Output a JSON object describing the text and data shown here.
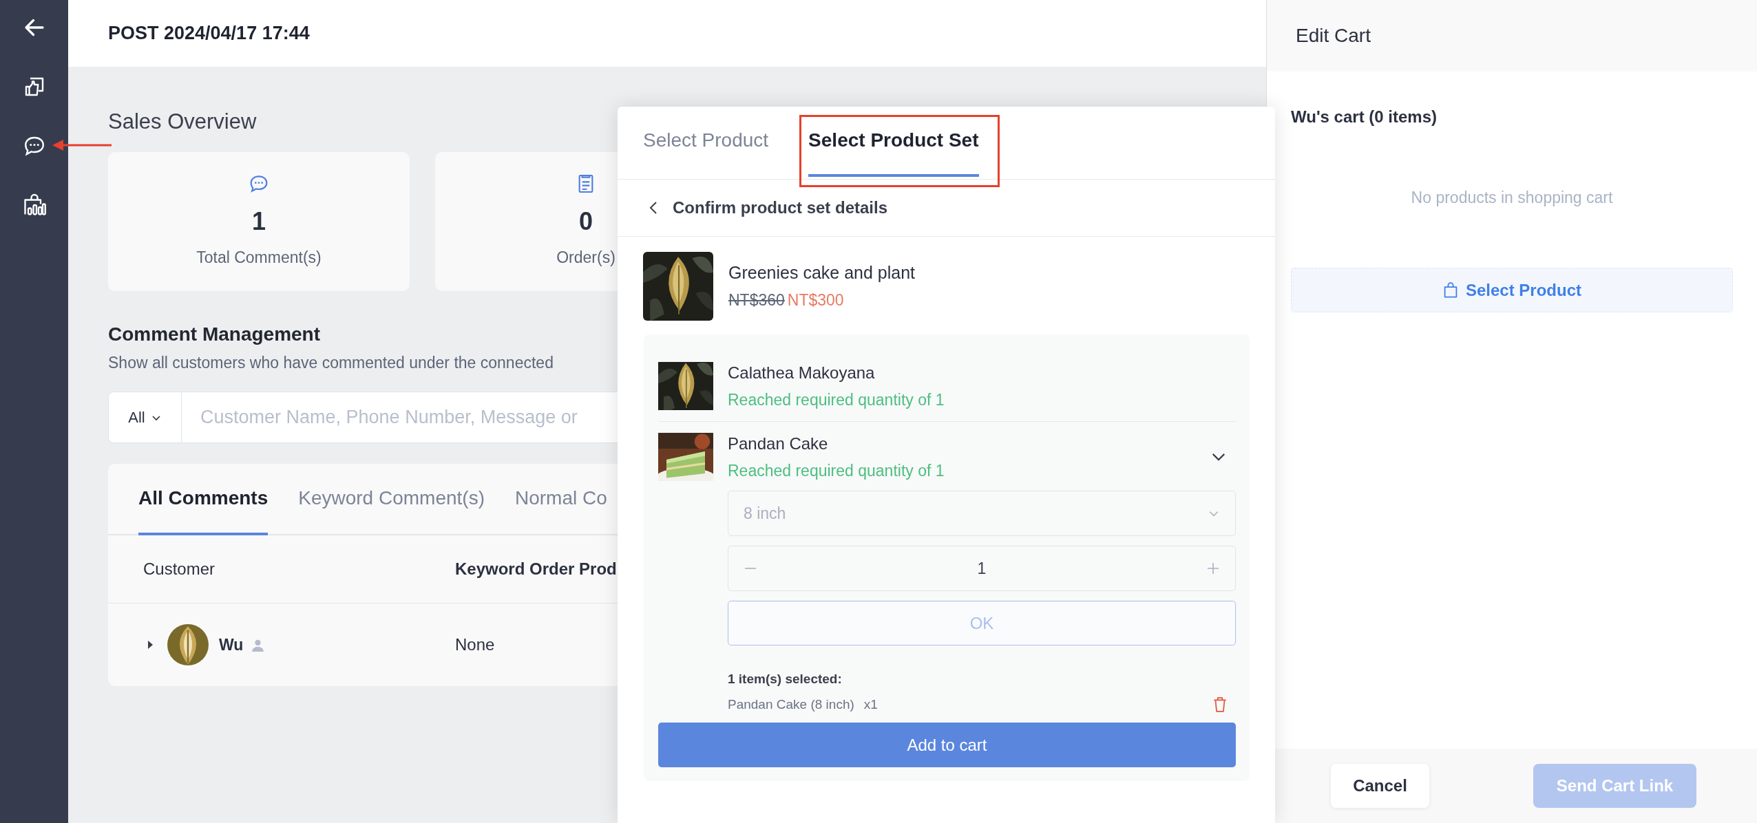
{
  "header": {
    "title": "POST 2024/04/17 17:44"
  },
  "sales_overview": {
    "title": "Sales Overview",
    "cards": [
      {
        "kind": "comments",
        "value": "1",
        "label": "Total Comment(s)"
      },
      {
        "kind": "orders",
        "value": "0",
        "label": "Order(s)"
      }
    ]
  },
  "comment_management": {
    "title": "Comment Management",
    "description": "Show all customers who have commented under the connected",
    "filter": {
      "value": "All"
    },
    "search": {
      "placeholder": "Customer Name, Phone Number, Message or"
    },
    "tabs": [
      {
        "label": "All Comments",
        "selected": true
      },
      {
        "label": "Keyword Comment(s)",
        "selected": false
      },
      {
        "label": "Normal Co",
        "selected": false
      }
    ],
    "columns": [
      "Customer",
      "Keyword Order Prod"
    ],
    "rows": [
      {
        "customer": "Wu",
        "expanded": false,
        "column_2": "None"
      }
    ]
  },
  "product_picker": {
    "tabs": [
      {
        "label": "Select Product",
        "selected": false
      },
      {
        "label": "Select Product Set",
        "selected": true
      }
    ],
    "back_title": "Confirm product set details",
    "product": {
      "name": "Greenies cake and plant",
      "original_price": "NT$360",
      "price": "NT$300"
    },
    "items": [
      {
        "name": "Calathea Makoyana",
        "status": "Reached required quantity of 1",
        "expanded": false
      },
      {
        "name": "Pandan Cake",
        "status": "Reached required quantity of 1",
        "expanded": true,
        "option": {
          "value": "8 inch"
        },
        "quantity": "1",
        "confirm_button": {
          "label": "OK",
          "disabled": true
        }
      }
    ],
    "selected_summary": "1 item(s) selected:",
    "selected_items": [
      {
        "name": "Pandan Cake (8 inch)",
        "quantity": "x1"
      }
    ],
    "add_button": "Add to cart"
  },
  "cart_drawer": {
    "title": "Edit Cart",
    "cart_title": "Wu's cart (0 items)",
    "empty_text": "No products in shopping cart",
    "select_button": "Select Product",
    "cancel_button": "Cancel",
    "send_button": {
      "label": "Send Cart Link",
      "disabled": true
    }
  }
}
